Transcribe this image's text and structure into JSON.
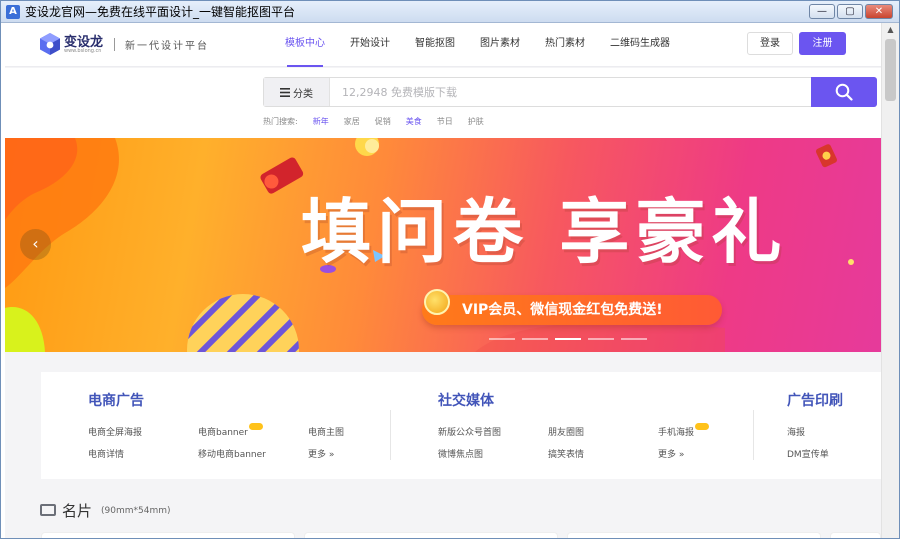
{
  "window": {
    "title": "变设龙官网—免费在线平面设计_一键智能抠图平台",
    "app_icon": "A",
    "controls": {
      "minimize": "—",
      "maximize": "▢",
      "close": "✕"
    }
  },
  "header": {
    "logo_text": "变设龙",
    "logo_sub": "www.bslong.cn",
    "slogan": "新一代设计平台",
    "nav": [
      {
        "label": "模板中心",
        "active": true
      },
      {
        "label": "开始设计",
        "active": false
      },
      {
        "label": "智能抠图",
        "active": false
      },
      {
        "label": "图片素材",
        "active": false
      },
      {
        "label": "热门素材",
        "active": false
      },
      {
        "label": "二维码生成器",
        "active": false
      }
    ],
    "login_label": "登录",
    "register_label": "注册"
  },
  "search": {
    "category_label": "分类",
    "placeholder": "12,2948 免费模版下载",
    "hot_label": "热门搜索:",
    "hot_tags": [
      "新年",
      "家居",
      "促销",
      "美食",
      "节日",
      "护肤"
    ],
    "highlight_tags": [
      0,
      3
    ]
  },
  "banner": {
    "headline": "填问卷 享豪礼",
    "pill_text": "VIP会员、微信现金红包免费送!",
    "prev_arrow": "‹",
    "slide_count": 5,
    "active_slide": 2
  },
  "categories": [
    {
      "title": "电商广告",
      "links": [
        "电商全屏海报",
        "电商banner",
        "电商主图",
        "电商详情",
        "移动电商banner",
        "更多 »"
      ],
      "hot_index": 1
    },
    {
      "title": "社交媒体",
      "links": [
        "新版公众号首图",
        "朋友圈图",
        "手机海报",
        "微博焦点图",
        "搞笑表情",
        "更多 »"
      ],
      "hot_index": 2
    },
    {
      "title": "广告印刷",
      "links": [
        "海报",
        "DM宣传单"
      ]
    }
  ],
  "section": {
    "title": "名片",
    "subtitle": "(90mm*54mm)"
  },
  "colors": {
    "accent": "#6b55f0",
    "category_title": "#4255b9",
    "hot_badge": "#ffc21a"
  }
}
